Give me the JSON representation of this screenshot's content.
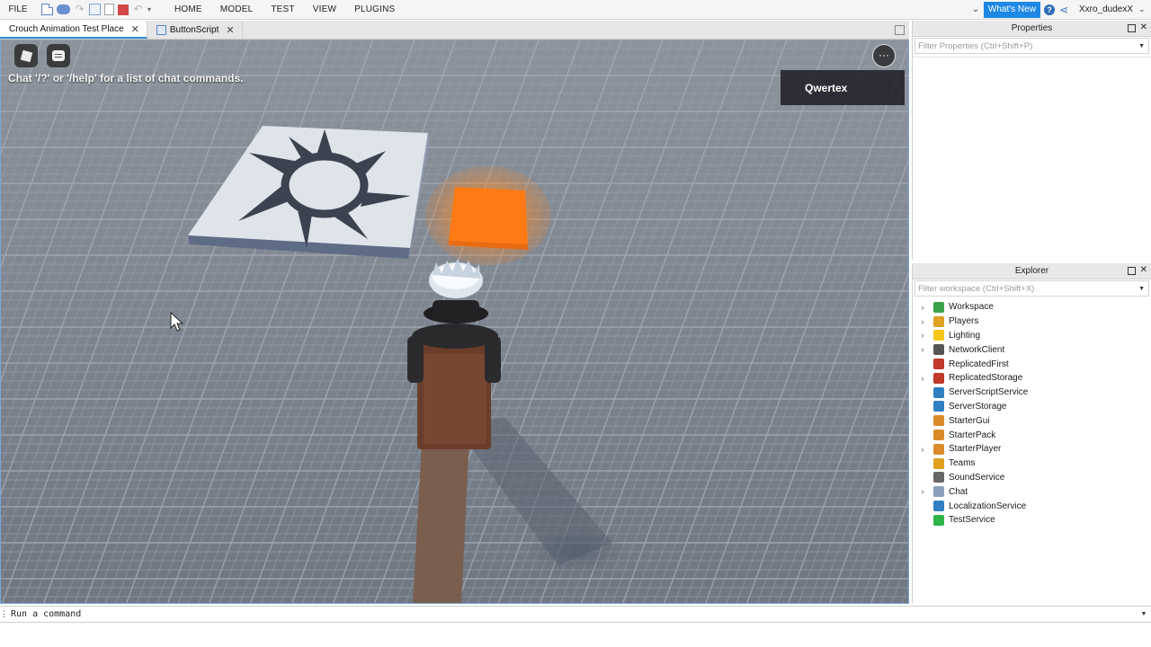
{
  "menubar": {
    "file_label": "FILE",
    "tabs": [
      "HOME",
      "MODEL",
      "TEST",
      "VIEW",
      "PLUGINS"
    ],
    "whats_new_label": "What's New",
    "help_icon": "?",
    "username": "Xxro_dudexX"
  },
  "doc_tabs": [
    {
      "label": "Crouch Animation Test Place",
      "active": true
    },
    {
      "label": "ButtonScript",
      "active": false
    }
  ],
  "viewport": {
    "chat_hint": "Chat '/?' or '/help' for a list of chat commands.",
    "player_name": "Qwertex",
    "more_menu_glyph": "···"
  },
  "properties": {
    "title": "Properties",
    "filter_placeholder": "Filter Properties (Ctrl+Shift+P)"
  },
  "explorer": {
    "title": "Explorer",
    "filter_placeholder": "Filter workspace (Ctrl+Shift+X)",
    "items": [
      {
        "label": "Workspace",
        "expandable": true,
        "icon": "globe-icon",
        "color": "#3aa34a"
      },
      {
        "label": "Players",
        "expandable": true,
        "icon": "players-icon",
        "color": "#e0a020"
      },
      {
        "label": "Lighting",
        "expandable": true,
        "icon": "lightbulb-icon",
        "color": "#f5c518"
      },
      {
        "label": "NetworkClient",
        "expandable": true,
        "icon": "network-icon",
        "color": "#555555"
      },
      {
        "label": "ReplicatedFirst",
        "expandable": false,
        "icon": "replicated-first-icon",
        "color": "#c0392b"
      },
      {
        "label": "ReplicatedStorage",
        "expandable": true,
        "icon": "replicated-storage-icon",
        "color": "#c0392b"
      },
      {
        "label": "ServerScriptService",
        "expandable": false,
        "icon": "server-script-icon",
        "color": "#2f7fc1"
      },
      {
        "label": "ServerStorage",
        "expandable": false,
        "icon": "server-storage-icon",
        "color": "#2f7fc1"
      },
      {
        "label": "StarterGui",
        "expandable": false,
        "icon": "starter-gui-icon",
        "color": "#d98b2b"
      },
      {
        "label": "StarterPack",
        "expandable": false,
        "icon": "starter-pack-icon",
        "color": "#d98b2b"
      },
      {
        "label": "StarterPlayer",
        "expandable": true,
        "icon": "starter-player-icon",
        "color": "#d98b2b"
      },
      {
        "label": "Teams",
        "expandable": false,
        "icon": "teams-icon",
        "color": "#e0a020"
      },
      {
        "label": "SoundService",
        "expandable": false,
        "icon": "speaker-icon",
        "color": "#666666"
      },
      {
        "label": "Chat",
        "expandable": true,
        "icon": "chat-bubble-icon",
        "color": "#8aa0b8"
      },
      {
        "label": "LocalizationService",
        "expandable": false,
        "icon": "localization-globe-icon",
        "color": "#2f7fc1"
      },
      {
        "label": "TestService",
        "expandable": false,
        "icon": "checkmark-icon",
        "color": "#2eb34a"
      }
    ]
  },
  "command_bar": {
    "placeholder": "Run a command"
  }
}
